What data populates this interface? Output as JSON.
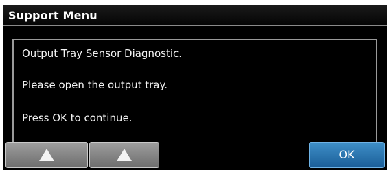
{
  "title": "Support Menu",
  "message": {
    "line1": "Output Tray Sensor Diagnostic.",
    "line2": "Please open the output tray.",
    "line3": "Press OK to continue."
  },
  "buttons": {
    "up1_icon": "up-arrow-icon",
    "up2_icon": "up-arrow-icon",
    "ok_label": "OK"
  },
  "colors": {
    "background": "#000000",
    "ok_button": "#2a75b3",
    "nav_button": "#8a8a8a"
  }
}
